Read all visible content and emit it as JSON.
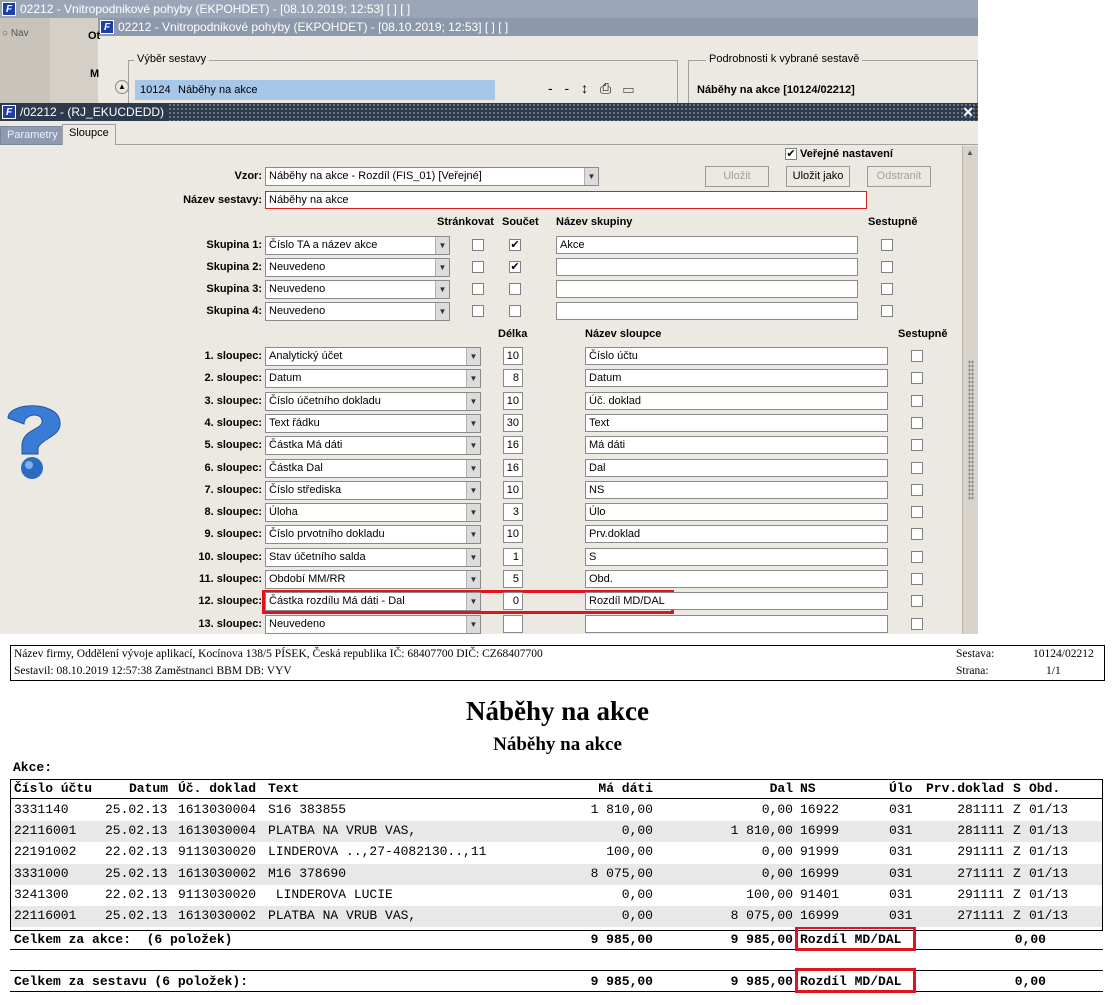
{
  "bg": {
    "title1": "02212 - Vnitropodnikové pohyby (EKPOHDET) - [08.10.2019; 12:53]  [ ]  [ ]",
    "title2": "02212 - Vnitropodnikové pohyby (EKPOHDET) - [08.10.2019; 12:53]  [ ]  [ ]",
    "nav": "Nav",
    "ot": "Ot",
    "m": "M",
    "select_group": "Výběr sestavy",
    "detail_group": "Podrobnosti k vybrané sestavě",
    "selected_code": "10124",
    "selected_name": "Náběhy na akce",
    "detail_name": "Náběhy na akce [10124/02212]",
    "icons": "- -  ↕ ⎙ ▭"
  },
  "dialog": {
    "title": "/02212 - (RJ_EKUCDEDD)",
    "close": "✕",
    "tabs": [
      "Parametry",
      "Sloupce"
    ],
    "public_label": "Veřejné nastavení",
    "public_checked": true,
    "vzor_label": "Vzor:",
    "vzor_value": "Náběhy na akce - Rozdíl   (FIS_01)   [Veřejné]",
    "buttons": {
      "save": "Uložit",
      "save_as": "Uložit jako",
      "delete": "Odstranit"
    },
    "name_label": "Název sestavy:",
    "name_value": "Náběhy na akce",
    "group_headers": {
      "page": "Stránkovat",
      "sum": "Součet",
      "group_name": "Název skupiny",
      "desc": "Sestupně"
    },
    "groups": [
      {
        "label": "Skupina 1:",
        "value": "Číslo TA a název akce",
        "page": false,
        "sum": true,
        "name": "Akce",
        "desc": false
      },
      {
        "label": "Skupina 2:",
        "value": "Neuvedeno",
        "page": false,
        "sum": true,
        "name": "",
        "desc": false
      },
      {
        "label": "Skupina 3:",
        "value": "Neuvedeno",
        "page": false,
        "sum": false,
        "name": "",
        "desc": false
      },
      {
        "label": "Skupina 4:",
        "value": "Neuvedeno",
        "page": false,
        "sum": false,
        "name": "",
        "desc": false
      }
    ],
    "col_headers": {
      "length": "Délka",
      "col_name": "Název sloupce",
      "desc": "Sestupně"
    },
    "columns": [
      {
        "label": "1. sloupec:",
        "value": "Analytický účet",
        "len": "10",
        "name": "Číslo účtu"
      },
      {
        "label": "2. sloupec:",
        "value": "Datum",
        "len": "8",
        "name": "Datum"
      },
      {
        "label": "3. sloupec:",
        "value": "Číslo účetního dokladu",
        "len": "10",
        "name": "Úč. doklad"
      },
      {
        "label": "4. sloupec:",
        "value": "Text řádku",
        "len": "30",
        "name": "Text"
      },
      {
        "label": "5. sloupec:",
        "value": "Částka Má dáti",
        "len": "16",
        "name": "Má dáti"
      },
      {
        "label": "6. sloupec:",
        "value": "Částka Dal",
        "len": "16",
        "name": "Dal"
      },
      {
        "label": "7. sloupec:",
        "value": "Číslo střediska",
        "len": "10",
        "name": "NS"
      },
      {
        "label": "8. sloupec:",
        "value": "Úloha",
        "len": "3",
        "name": "Úlo"
      },
      {
        "label": "9. sloupec:",
        "value": "Číslo prvotního dokladu",
        "len": "10",
        "name": "Prv.doklad"
      },
      {
        "label": "10. sloupec:",
        "value": "Stav účetního salda",
        "len": "1",
        "name": "S"
      },
      {
        "label": "11. sloupec:",
        "value": "Období MM/RR",
        "len": "5",
        "name": "Obd."
      },
      {
        "label": "12. sloupec:",
        "value": "Částka rozdílu Má dáti - Dal",
        "len": "0",
        "name": "Rozdíl MD/DAL"
      },
      {
        "label": "13. sloupec:",
        "value": "Neuvedeno",
        "len": "",
        "name": ""
      }
    ]
  },
  "report": {
    "firm_line": "Název firmy, Oddělení vývoje aplikací, Kocínova 138/5 PÍSEK, Česká republika  IČ: 68407700  DIČ: CZ68407700",
    "author_line": "Sestavil: 08.10.2019 12:57:38 Zaměstnanci BBM  DB: VYV",
    "sestava_label": "Sestava:",
    "sestava_value": "10124/02212",
    "strana_label": "Strana:",
    "strana_value": "1/1",
    "title": "Náběhy na akce",
    "subtitle": "Náběhy na akce",
    "group_label": "Akce:",
    "headers": [
      "Číslo účtu",
      "Datum",
      "Úč. doklad",
      "Text",
      "Má dáti",
      "Dal",
      "NS",
      "Úlo",
      "Prv.doklad",
      "S",
      "Obd."
    ],
    "rows": [
      [
        "3331140",
        "25.02.13",
        "1613030004",
        "S16 383855",
        "1 810,00",
        "0,00",
        "16922",
        "031",
        "281111",
        "Z",
        "01/13"
      ],
      [
        "22116001",
        "25.02.13",
        "1613030004",
        "PLATBA NA VRUB VAS,",
        "0,00",
        "1 810,00",
        "16999",
        "031",
        "281111",
        "Z",
        "01/13"
      ],
      [
        "22191002",
        "22.02.13",
        "9113030020",
        "LINDEROVA ..,27-4082130..,11",
        "100,00",
        "0,00",
        "91999",
        "031",
        "291111",
        "Z",
        "01/13"
      ],
      [
        "3331000",
        "25.02.13",
        "1613030002",
        "M16 378690",
        "8 075,00",
        "0,00",
        "16999",
        "031",
        "271111",
        "Z",
        "01/13"
      ],
      [
        "3241300",
        "22.02.13",
        "9113030020",
        " LINDEROVA LUCIE",
        "0,00",
        "100,00",
        "91401",
        "031",
        "291111",
        "Z",
        "01/13"
      ],
      [
        "22116001",
        "25.02.13",
        "1613030002",
        "PLATBA NA VRUB VAS,",
        "0,00",
        "8 075,00",
        "16999",
        "031",
        "271111",
        "Z",
        "01/13"
      ]
    ],
    "sum_group": {
      "label": "Celkem za akce:  (6 položek)",
      "md": "9 985,00",
      "dal": "9 985,00",
      "diff_label": "Rozdíl MD/DAL",
      "diff": "0,00"
    },
    "sum_total": {
      "label": "Celkem za sestavu (6 položek):",
      "md": "9 985,00",
      "dal": "9 985,00",
      "diff_label": "Rozdíl MD/DAL",
      "diff": "0,00"
    }
  }
}
